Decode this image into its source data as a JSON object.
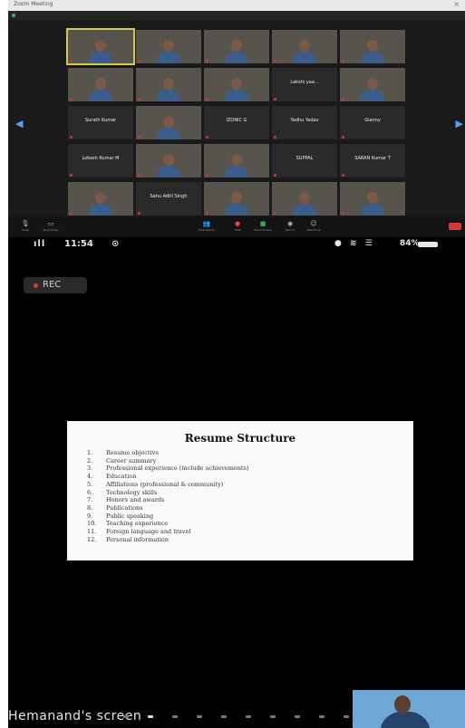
{
  "zoom": {
    "window_title": "Zoom Meeting",
    "tiles": [
      {
        "name": "",
        "caption": "",
        "video": true,
        "active": true
      },
      {
        "name": "",
        "caption": "",
        "video": true,
        "active": false
      },
      {
        "name": "",
        "caption": "",
        "video": true,
        "active": false
      },
      {
        "name": "",
        "caption": "",
        "video": true,
        "active": false
      },
      {
        "name": "",
        "caption": "",
        "video": true,
        "active": false
      },
      {
        "name": "",
        "caption": "",
        "video": true,
        "active": false
      },
      {
        "name": "",
        "caption": "",
        "video": true,
        "active": false
      },
      {
        "name": "",
        "caption": "",
        "video": true,
        "active": false
      },
      {
        "name": "Lakshi yaa...",
        "caption": "",
        "video": false,
        "active": false
      },
      {
        "name": "",
        "caption": "",
        "video": true,
        "active": false
      },
      {
        "name": "Surath Kumar",
        "caption": "",
        "video": false,
        "active": false
      },
      {
        "name": "",
        "caption": "",
        "video": true,
        "active": false
      },
      {
        "name": "IZONIC G",
        "caption": "",
        "video": false,
        "active": false
      },
      {
        "name": "Yadhu Yadav",
        "caption": "",
        "video": false,
        "active": false
      },
      {
        "name": "Glanny",
        "caption": "",
        "video": false,
        "active": false
      },
      {
        "name": "Lokesh Kumar M",
        "caption": "",
        "video": false,
        "active": false
      },
      {
        "name": "",
        "caption": "",
        "video": true,
        "active": false
      },
      {
        "name": "",
        "caption": "",
        "video": true,
        "active": false
      },
      {
        "name": "SUPPAL",
        "caption": "",
        "video": false,
        "active": false
      },
      {
        "name": "SARAN Kumar T",
        "caption": "",
        "video": false,
        "active": false
      },
      {
        "name": "",
        "caption": "",
        "video": true,
        "active": false
      },
      {
        "name": "Sahu Aditi Singh",
        "caption": "",
        "video": false,
        "active": false
      },
      {
        "name": "",
        "caption": "",
        "video": true,
        "active": false
      },
      {
        "name": "",
        "caption": "",
        "video": true,
        "active": false
      },
      {
        "name": "",
        "caption": "",
        "video": true,
        "active": false
      }
    ],
    "toolbar": {
      "mute": "Mute",
      "video": "Start Video",
      "participants": "Participants",
      "chat": "Chat",
      "share": "Share Screen",
      "record": "Record",
      "reactions": "Reactions"
    }
  },
  "phone": {
    "time": "11:54",
    "battery": "84%",
    "rec_label": "REC",
    "presenter_label": "Hemanand's screen",
    "page_indicator": {
      "count": 10,
      "current": 2
    }
  },
  "slide": {
    "title": "Resume Structure",
    "items": [
      {
        "num": "1.",
        "text": "Resume objective"
      },
      {
        "num": "2.",
        "text": "Career summary"
      },
      {
        "num": "3.",
        "text": "Professional experience (include achievements)"
      },
      {
        "num": "4.",
        "text": "Education"
      },
      {
        "num": "5.",
        "text": "Affiliations (professional & community)"
      },
      {
        "num": "6.",
        "text": "Technology skills"
      },
      {
        "num": "7.",
        "text": "Honors and awards"
      },
      {
        "num": "8.",
        "text": "Publications"
      },
      {
        "num": "9.",
        "text": "Public speaking"
      },
      {
        "num": "10.",
        "text": "Teaching experience"
      },
      {
        "num": "11.",
        "text": "Foreign language and travel"
      },
      {
        "num": "12.",
        "text": "Personal information"
      }
    ]
  }
}
